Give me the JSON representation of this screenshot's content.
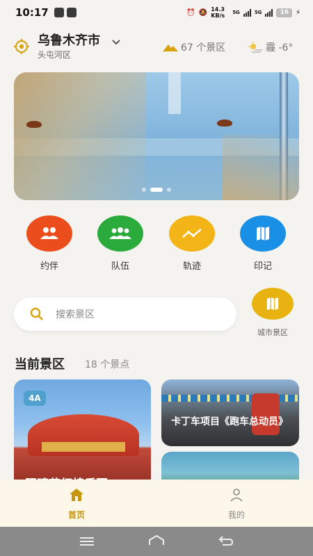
{
  "status_bar": {
    "time": "10:17",
    "net_speed": "14.3 KB/s",
    "signal_1": "5G",
    "signal_2": "5G",
    "battery": "16"
  },
  "header": {
    "city": "乌鲁木齐市",
    "district": "头屯河区",
    "scenic_count": "67 个景区",
    "weather": "霾 -6°"
  },
  "banner": {
    "page_count": 3,
    "active_index": 1
  },
  "quick_actions": [
    {
      "label": "约伴",
      "color": "#ec4d1c",
      "icon": "people-pair-icon"
    },
    {
      "label": "队伍",
      "color": "#2aab3c",
      "icon": "group-icon"
    },
    {
      "label": "轨迹",
      "color": "#f3b417",
      "icon": "trend-line-icon"
    },
    {
      "label": "印记",
      "color": "#1a8fe6",
      "icon": "map-book-icon"
    }
  ],
  "search": {
    "placeholder": "搜索景区"
  },
  "city_scenic": {
    "label": "城市景区"
  },
  "section": {
    "title": "当前景区",
    "count": "18 个景点"
  },
  "cards": [
    {
      "badge": "4A",
      "title": "阳晴花红棉乐园"
    },
    {
      "title": "卡丁车项目《跑车总动员》"
    }
  ],
  "tabs": [
    {
      "label": "首页",
      "active": true
    },
    {
      "label": "我的",
      "active": false
    }
  ],
  "colors": {
    "accent": "#d9a310",
    "tab_active": "#c8960c",
    "tab_inactive": "#888888",
    "tab_bar_bg": "#fcf7e8"
  }
}
